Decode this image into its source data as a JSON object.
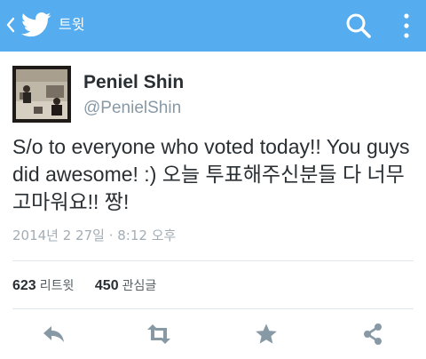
{
  "app_bar": {
    "title": "트윗",
    "background_color": "#55acee",
    "icons": [
      "back-chevron-icon",
      "twitter-bird-icon",
      "search-icon",
      "overflow-menu-icon"
    ]
  },
  "tweet": {
    "author_name": "Peniel Shin",
    "author_handle": "@PenielShin",
    "text": "S/o to everyone who voted today!! You guys did awesome! :)  오늘 투표해주신분들 다 너무 고마워요!! 짱!",
    "timestamp": "2014년 2 27일 · 8:12 오후"
  },
  "stats": {
    "retweets_count": "623",
    "retweets_label": "리트윗",
    "favorites_count": "450",
    "favorites_label": "관심글"
  },
  "actions": [
    "reply-icon",
    "retweet-icon",
    "favorite-icon",
    "share-icon"
  ]
}
